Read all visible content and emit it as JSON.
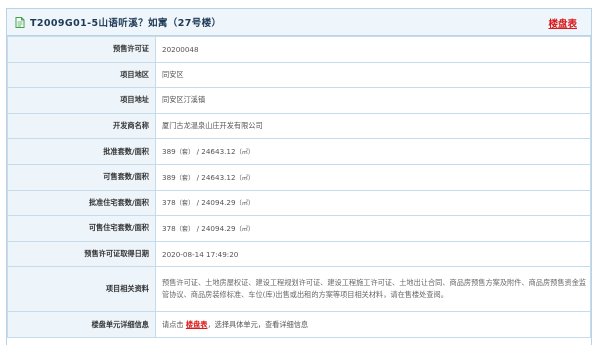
{
  "header": {
    "title": "T2009G01-5山语听溪？如寓（27号楼）",
    "link_label": "楼盘表"
  },
  "rows": [
    {
      "label": "预售许可证",
      "value": "20200048"
    },
    {
      "label": "项目地区",
      "value": "同安区"
    },
    {
      "label": "项目地址",
      "value": "同安区汀溪镇"
    },
    {
      "label": "开发商名称",
      "value": "厦门古龙温泉山庄开发有限公司"
    },
    {
      "label": "批准套数/面积",
      "count": "389",
      "unit_count": "（套）",
      "area": "/ 24643.12",
      "unit_area": "（㎡）"
    },
    {
      "label": "可售套数/面积",
      "count": "389",
      "unit_count": "（套）",
      "area": "/ 24643.12",
      "unit_area": "（㎡）"
    },
    {
      "label": "批准住宅套数/面积",
      "count": "378",
      "unit_count": "（套）",
      "area": "/ 24094.29",
      "unit_area": "（㎡）"
    },
    {
      "label": "可售住宅套数/面积",
      "count": "378",
      "unit_count": "（套）",
      "area": "/ 24094.29",
      "unit_area": "（㎡）"
    },
    {
      "label": "预售许可证取得日期",
      "value": "2020-08-14 17:49:20"
    },
    {
      "label": "项目相关资料",
      "value": "预售许可证、土地房屋权证、建设工程规划许可证、建设工程施工许可证、土地出让合同、商品房预售方案及附件、商品房预售资金监管协议、商品房装修标准、车位(库)出售或出租的方案等项目相关材料，请在售楼处查阅。"
    },
    {
      "label": "楼盘单元详细信息",
      "prefix": "请点击",
      "link": "楼盘表",
      "suffix": "，选择具体单元，查看详细信息"
    }
  ]
}
